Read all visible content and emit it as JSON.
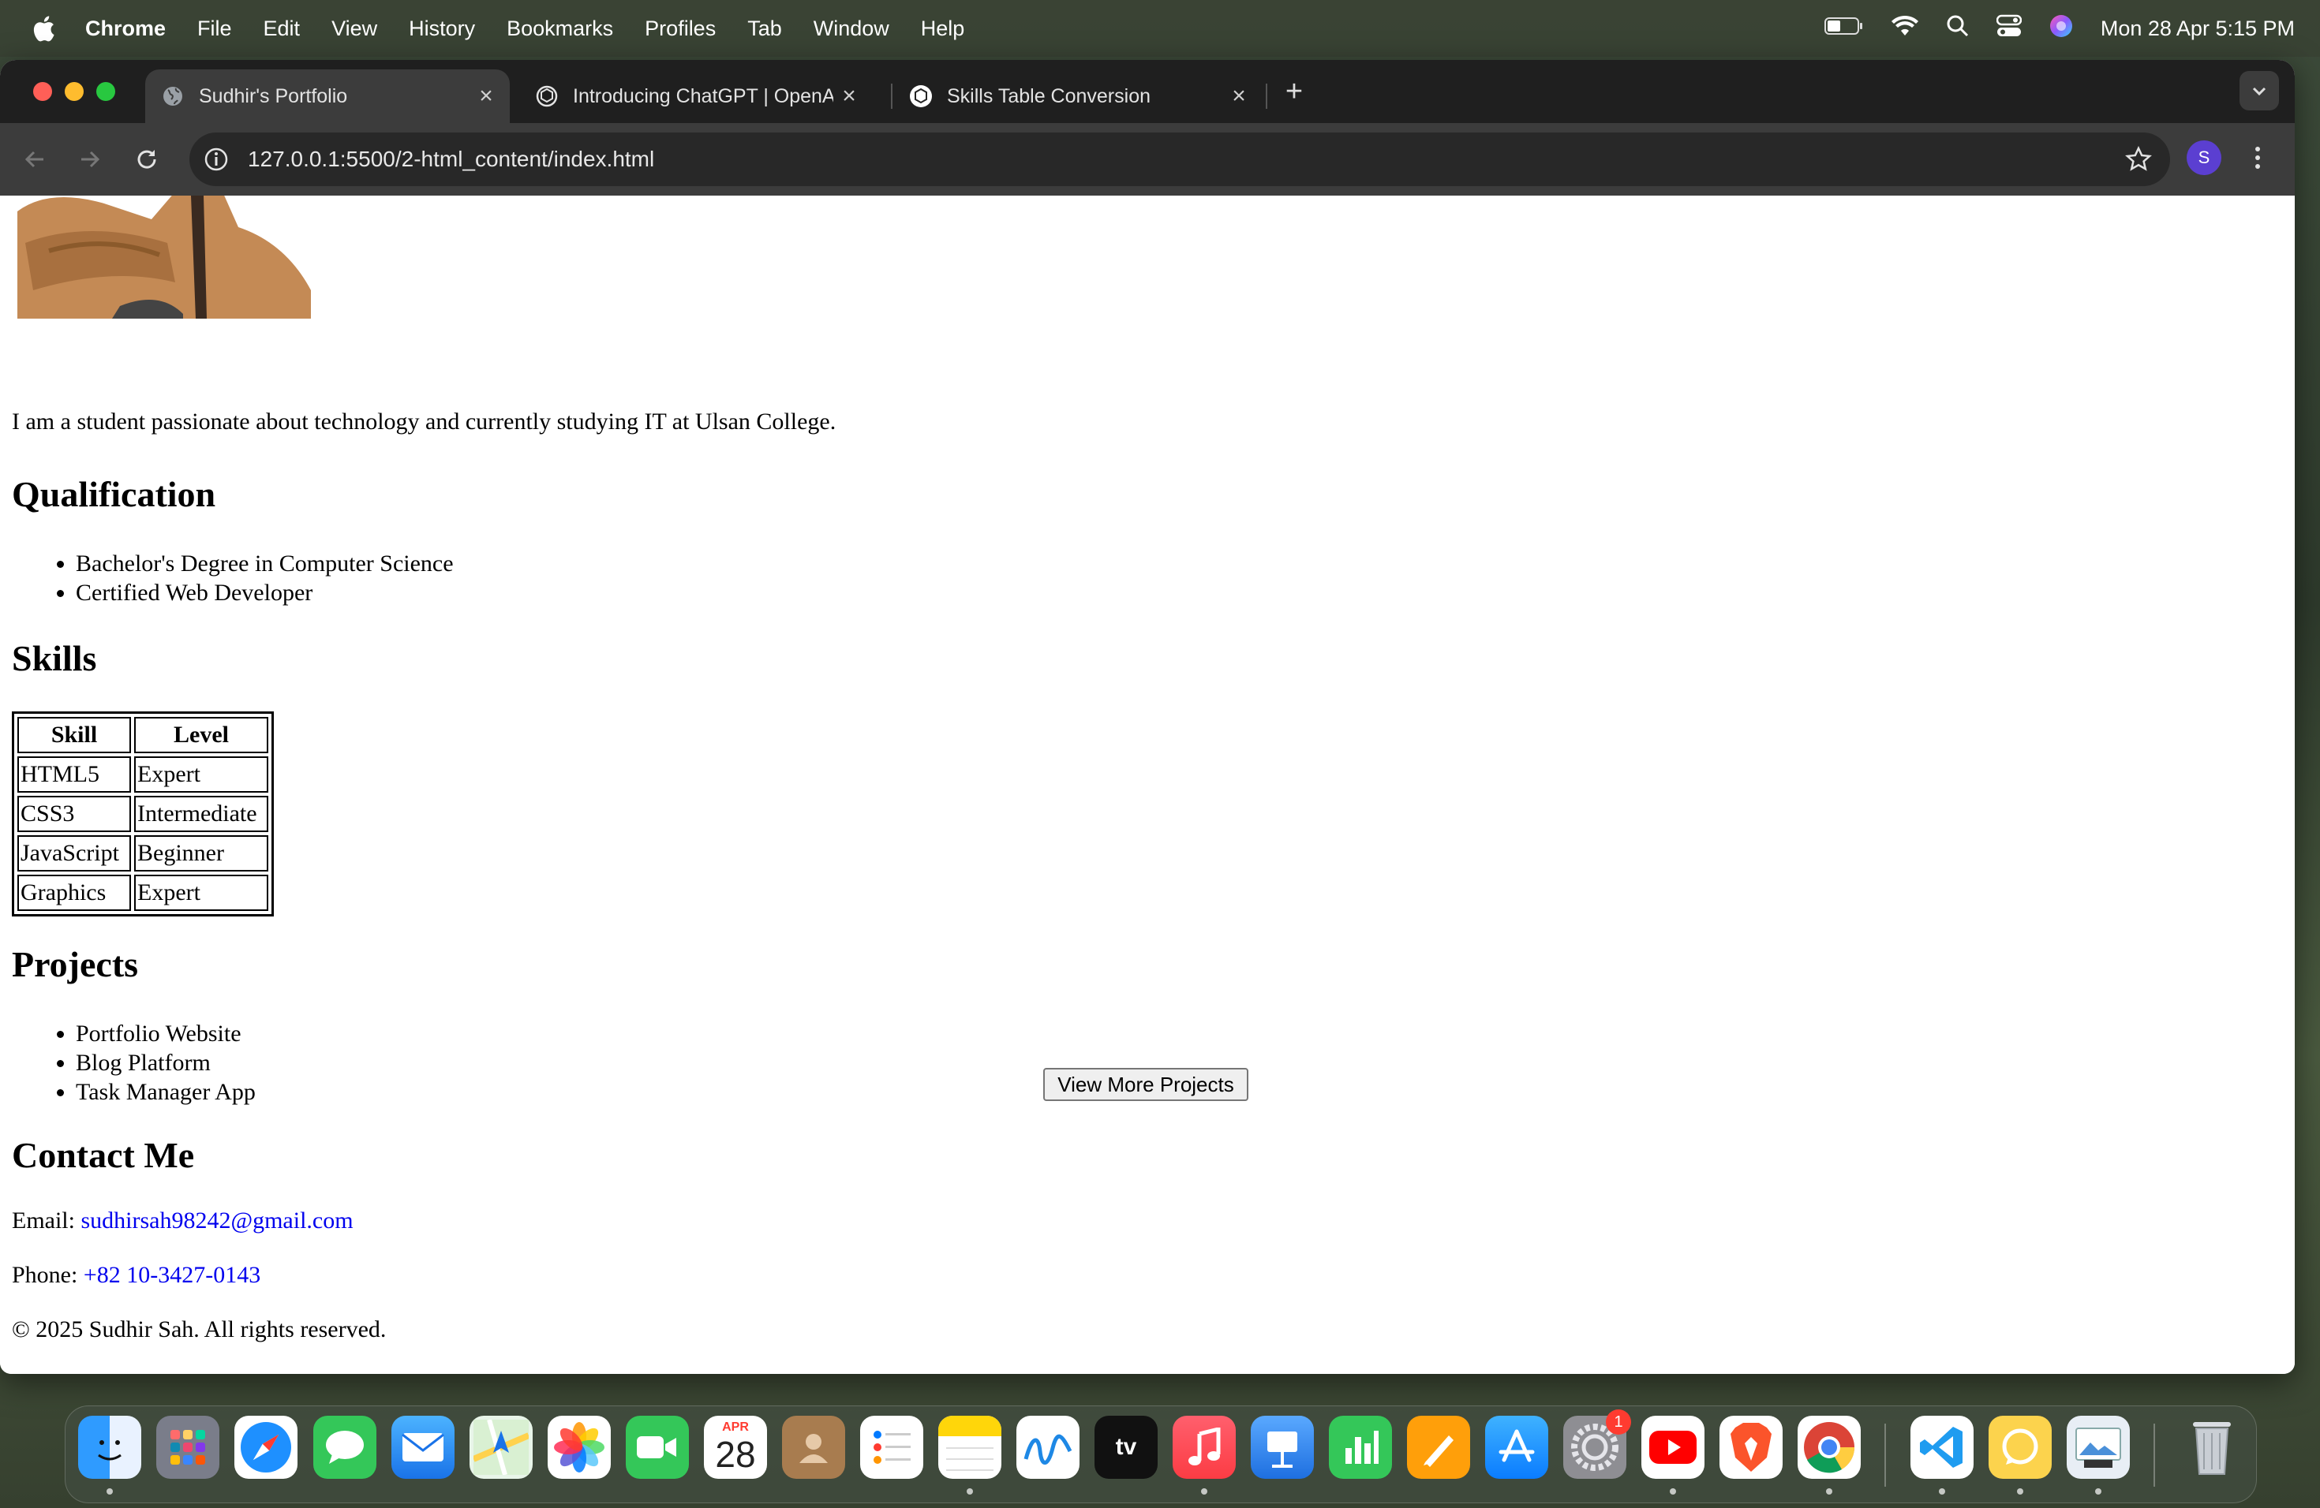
{
  "menubar": {
    "app_name": "Chrome",
    "items": [
      "File",
      "Edit",
      "View",
      "History",
      "Bookmarks",
      "Profiles",
      "Tab",
      "Window",
      "Help"
    ],
    "clock": "Mon 28 Apr  5:15 PM",
    "status_icons": [
      "battery-icon",
      "wifi-icon",
      "spotlight-search-icon",
      "control-center-icon",
      "siri-icon"
    ]
  },
  "browser": {
    "tabs": [
      {
        "title": "Sudhir's Portfolio",
        "favicon": "globe-icon",
        "active": true
      },
      {
        "title": "Introducing ChatGPT | OpenAI",
        "favicon": "openai-icon",
        "active": false
      },
      {
        "title": "Skills Table Conversion",
        "favicon": "openai-icon",
        "active": false
      }
    ],
    "url": "127.0.0.1:5500/2-html_content/index.html",
    "profile_initial": "S"
  },
  "page": {
    "intro": "I am a student passionate about technology and currently studying IT at Ulsan College.",
    "qualification_heading": "Qualification",
    "qualifications": [
      "Bachelor's Degree in Computer Science",
      "Certified Web Developer"
    ],
    "skills_heading": "Skills",
    "skills_table": {
      "headers": [
        "Skill",
        "Level"
      ],
      "rows": [
        [
          "HTML5",
          "Expert"
        ],
        [
          "CSS3",
          "Intermediate"
        ],
        [
          "JavaScript",
          "Beginner"
        ],
        [
          "Graphics",
          "Expert"
        ]
      ]
    },
    "projects_heading": "Projects",
    "projects": [
      "Portfolio Website",
      "Blog Platform",
      "Task Manager App"
    ],
    "more_button": "View More Projects",
    "contact_heading": "Contact Me",
    "email_label": "Email:",
    "email": "sudhirsah98242@gmail.com",
    "phone_label": "Phone:",
    "phone": "+82 10-3427-0143",
    "footer": "© 2025 Sudhir Sah. All rights reserved."
  },
  "dock": {
    "calendar_month": "APR",
    "calendar_day": "28",
    "settings_badge": "1",
    "apps": [
      "finder-icon",
      "launchpad-icon",
      "safari-icon",
      "messages-icon",
      "mail-icon",
      "maps-icon",
      "photos-icon",
      "facetime-icon",
      "calendar-icon",
      "contacts-icon",
      "reminders-icon",
      "notes-icon",
      "freeform-icon",
      "apple-tv-icon",
      "music-icon",
      "keynote-icon",
      "numbers-icon",
      "pages-icon",
      "app-store-icon",
      "system-settings-icon",
      "youtube-icon",
      "brave-icon",
      "chrome-icon",
      "vscode-icon",
      "whatsapp-icon",
      "preview-icon",
      "trash-icon"
    ]
  }
}
